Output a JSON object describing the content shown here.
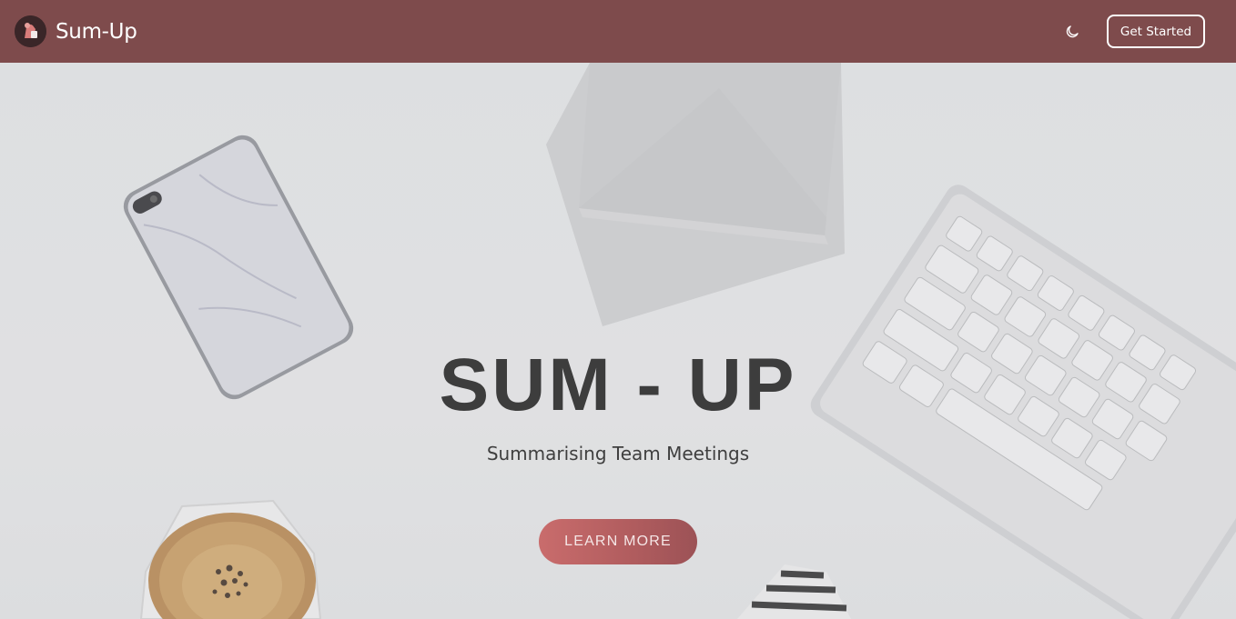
{
  "nav": {
    "brand": "Sum-Up",
    "cta_label": "Get Started"
  },
  "hero": {
    "title": "SUM - UP",
    "subtitle": "Summarising Team Meetings",
    "button_label": "LEARN MORE"
  },
  "icons": {
    "logo": "brand-logo-icon",
    "theme": "moon-icon"
  },
  "colors": {
    "navbar": "#7e4b4c",
    "button": "#c96c6c",
    "title": "#3d3d3d"
  }
}
